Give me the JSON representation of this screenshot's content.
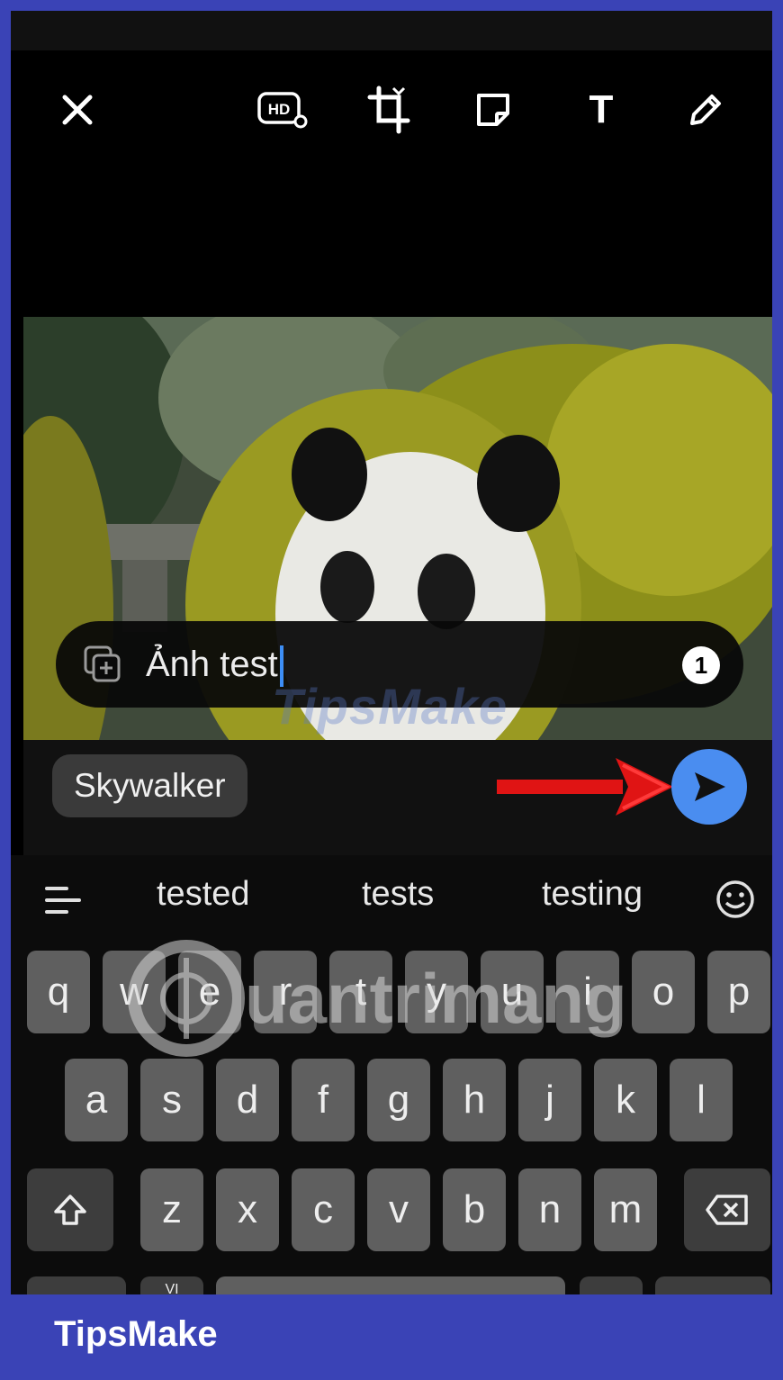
{
  "toolbar": {
    "close": "close-icon",
    "hd_label": "HD",
    "crop": "crop-icon",
    "sticker": "sticker-icon",
    "text_tool": "T",
    "draw": "pencil-icon"
  },
  "caption": {
    "text": "Ảnh test",
    "count": "1"
  },
  "sender": {
    "name": "Skywalker"
  },
  "suggestions": [
    "tested",
    "tests",
    "testing"
  ],
  "keyboard": {
    "row1": [
      "q",
      "w",
      "e",
      "r",
      "t",
      "y",
      "u",
      "i",
      "o",
      "p"
    ],
    "row2": [
      "a",
      "s",
      "d",
      "f",
      "g",
      "h",
      "j",
      "k",
      "l"
    ],
    "row3": [
      "z",
      "x",
      "c",
      "v",
      "b",
      "n",
      "m"
    ],
    "lang_label": "VI"
  },
  "watermarks": {
    "tipsmake_overlay": "TipsMake",
    "quantrimang": "uantrimang"
  },
  "footer": {
    "brand": "TipsMake"
  },
  "colors": {
    "frame": "#3a43b6",
    "send": "#4a8df0",
    "arrow": "#e01414",
    "cursor": "#3d8ef5"
  }
}
